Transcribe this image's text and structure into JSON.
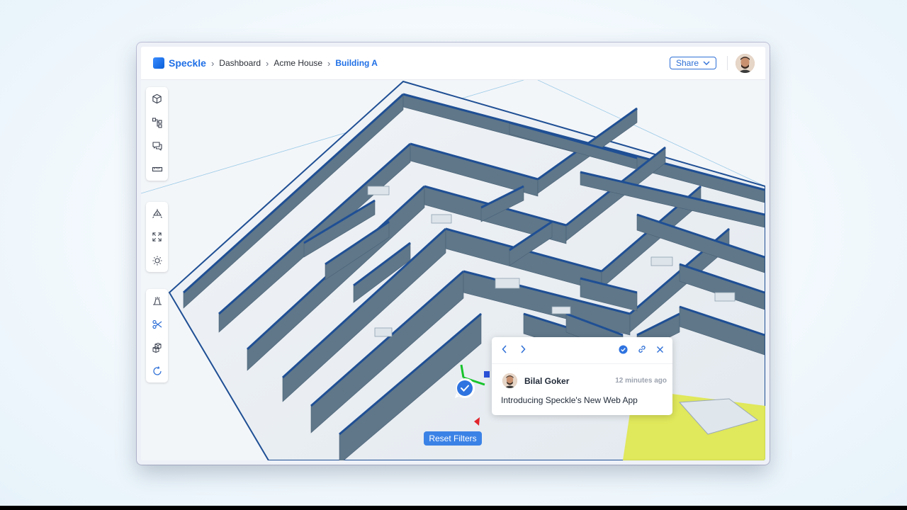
{
  "header": {
    "logo_text": "Speckle",
    "breadcrumbs": [
      "Dashboard",
      "Acme House",
      "Building A"
    ],
    "share_label": "Share"
  },
  "toolbar_groups": [
    {
      "tools": [
        "cube-icon",
        "scene-tree-icon",
        "comments-icon",
        "measure-icon"
      ]
    },
    {
      "tools": [
        "explode-icon",
        "zoom-extents-icon",
        "sun-icon"
      ]
    },
    {
      "tools": [
        "camera-views-icon",
        "section-scissors-icon",
        "models-icon",
        "reset-rotate-icon"
      ]
    }
  ],
  "comment": {
    "author": "Bilal Goker",
    "time": "12 minutes ago",
    "text": "Introducing Speckle's New Web App"
  },
  "reset_filters_label": "Reset Filters",
  "colors": {
    "accent": "#1f6fe6",
    "wall_edge": "#1f4f94",
    "wall_face": "#5f7789",
    "floor": "#eef2f6"
  }
}
